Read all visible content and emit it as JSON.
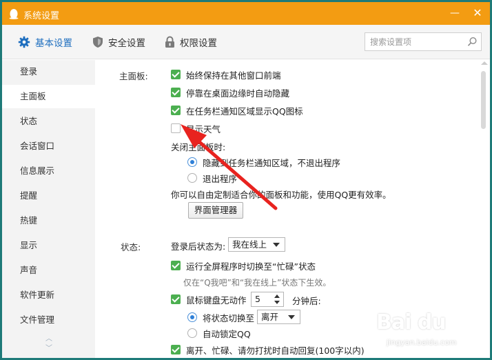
{
  "window": {
    "title": "系统设置",
    "minimize_glyph": "—",
    "close_glyph": "✕"
  },
  "toolbar": {
    "tabs": [
      {
        "label": "基本设置",
        "icon": "gear-icon",
        "active": true
      },
      {
        "label": "安全设置",
        "icon": "shield-icon",
        "active": false
      },
      {
        "label": "权限设置",
        "icon": "lock-icon",
        "active": false
      }
    ],
    "search_placeholder": "搜索设置项"
  },
  "sidebar": {
    "items": [
      {
        "label": "登录"
      },
      {
        "label": "主面板",
        "active": true
      },
      {
        "label": "状态"
      },
      {
        "label": "会话窗口"
      },
      {
        "label": "信息展示"
      },
      {
        "label": "提醒"
      },
      {
        "label": "热键"
      },
      {
        "label": "显示"
      },
      {
        "label": "声音"
      },
      {
        "label": "软件更新"
      },
      {
        "label": "文件管理"
      }
    ],
    "scroll_up_glyph": "︿",
    "scroll_down_glyph": "﹀"
  },
  "main_panel": {
    "section_label": "主面板:",
    "options": [
      {
        "label": "始终保持在其他窗口前端",
        "checked": true
      },
      {
        "label": "停靠在桌面边缘时自动隐藏",
        "checked": true
      },
      {
        "label": "在任务栏通知区域显示QQ图标",
        "checked": true
      },
      {
        "label": "显示天气",
        "checked": false
      }
    ],
    "close_label": "关闭主面板时:",
    "close_options": [
      {
        "label": "隐藏到任务栏通知区域，不退出程序",
        "selected": true
      },
      {
        "label": "退出程序",
        "selected": false
      }
    ],
    "customize_text": "你可以自由定制适合你的面板和功能，使用QQ更有效率。",
    "manager_button": "界面管理器"
  },
  "status": {
    "section_label": "状态:",
    "login_status_label": "登录后状态为:",
    "login_status_value": "我在线上",
    "fullscreen_option": {
      "label": "运行全屏程序时切换至“忙碌”状态",
      "checked": true
    },
    "fullscreen_hint": "仅在“Q我吧”和“我在线上”状态下生效。",
    "idle_option": {
      "label": "鼠标键盘无动作",
      "checked": true
    },
    "idle_minutes": "5",
    "idle_suffix": "分钟后:",
    "idle_actions": [
      {
        "label": "将状态切换至",
        "selected": true
      },
      {
        "label": "自动锁定QQ",
        "selected": false
      }
    ],
    "idle_status_value": "离开",
    "auto_reply_option": {
      "label": "离开、忙碌、请勿打扰时自动回复(100字以内)",
      "checked": true
    }
  },
  "watermark": {
    "logo": "Bai du",
    "url": "jingyan.baidu.com"
  },
  "colors": {
    "titlebar": "#f39c12",
    "active_tab": "#1f6fbf",
    "checkbox_on": "#4caf50",
    "annotation_arrow": "#e8231f",
    "frame": "#1e7a78"
  }
}
